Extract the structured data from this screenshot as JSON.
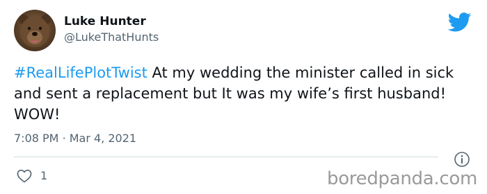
{
  "author": {
    "display_name": "Luke Hunter",
    "handle": "@LukeThatHunts",
    "avatar_icon": "bear-avatar"
  },
  "tweet": {
    "hashtag": "#RealLifePlotTwist",
    "body": " At my wedding the minister called in sick and sent a replacement but It was my wife’s first husband! WOW!",
    "time": "7:08 PM",
    "separator": "·",
    "date": "Mar 4, 2021"
  },
  "actions": {
    "like_icon": "heart-icon",
    "like_count": "1",
    "info_icon": "info-icon"
  },
  "brand": {
    "logo_icon": "twitter-bird-icon",
    "logo_color": "#1d9bf0",
    "hashtag_color": "#1d9bf0",
    "watermark": "boredpanda.com"
  }
}
